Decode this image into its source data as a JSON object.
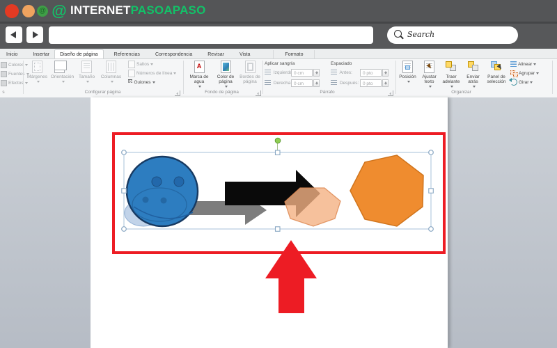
{
  "header": {
    "brand_white": "INTERNET",
    "brand_green": "PASOAPASO"
  },
  "chrome": {
    "search_label": "Search"
  },
  "tabs": [
    {
      "label": "Inicio"
    },
    {
      "label": "Insertar"
    },
    {
      "label": "Diseño de página",
      "active": true
    },
    {
      "label": "Referencias"
    },
    {
      "label": "Correspondencia"
    },
    {
      "label": "Revisar"
    },
    {
      "label": "Vista"
    },
    {
      "label": "Formato"
    }
  ],
  "themes": {
    "group_label_partial": "s",
    "items": [
      {
        "label": "Colores"
      },
      {
        "label": "Fuentes"
      },
      {
        "label": "Efectos"
      }
    ]
  },
  "page_setup": {
    "group_label": "Configurar página",
    "margins": "Márgenes",
    "orientation": "Orientación",
    "size": "Tamaño",
    "columns": "Columnas",
    "breaks": "Saltos",
    "line_numbers": "Números de línea",
    "hyphenation": "Guiones",
    "hyphenation_icon_text": "bc"
  },
  "page_background": {
    "group_label": "Fondo de página",
    "watermark": "Marca de agua",
    "watermark_icon_letter": "A",
    "page_color": "Color de página",
    "page_borders": "Bordes de página"
  },
  "paragraph": {
    "group_label": "Párrafo",
    "indent_header": "Aplicar sangría",
    "spacing_header": "Espaciado",
    "indent_left_label": "Izquierda:",
    "indent_left_value": "0 cm",
    "indent_right_label": "Derecha:",
    "indent_right_value": "0 cm",
    "spacing_before_label": "Antes:",
    "spacing_before_value": "0 pto",
    "spacing_after_label": "Después:",
    "spacing_after_value": "0 pto"
  },
  "arrange": {
    "group_label": "Organizar",
    "position": "Posición",
    "wrap_text": "Ajustar texto",
    "bring_forward": "Traer adelante",
    "send_backward": "Enviar atrás",
    "selection_pane": "Panel de selección",
    "align": "Alinear",
    "group": "Agrupar",
    "rotate": "Girar"
  },
  "colors": {
    "brand_green": "#12c268",
    "annotation_red": "#ed1c24",
    "shape_blue_fill": "#2d7dc0",
    "shape_blue_outline": "#173a62",
    "pale_blue_ellipse": "#b6cbe5",
    "arrow_black": "#0a0a0a",
    "arrow_gray": "#7d7d7d",
    "heptagon_orange_fill": "#ef8c2f",
    "heptagon_orange_stroke": "#d0741c",
    "heptagon_peach_translucent": "#f4b183",
    "selection_border_blue": "#a7c0d9",
    "rotation_handle_green": "#8fce52"
  }
}
